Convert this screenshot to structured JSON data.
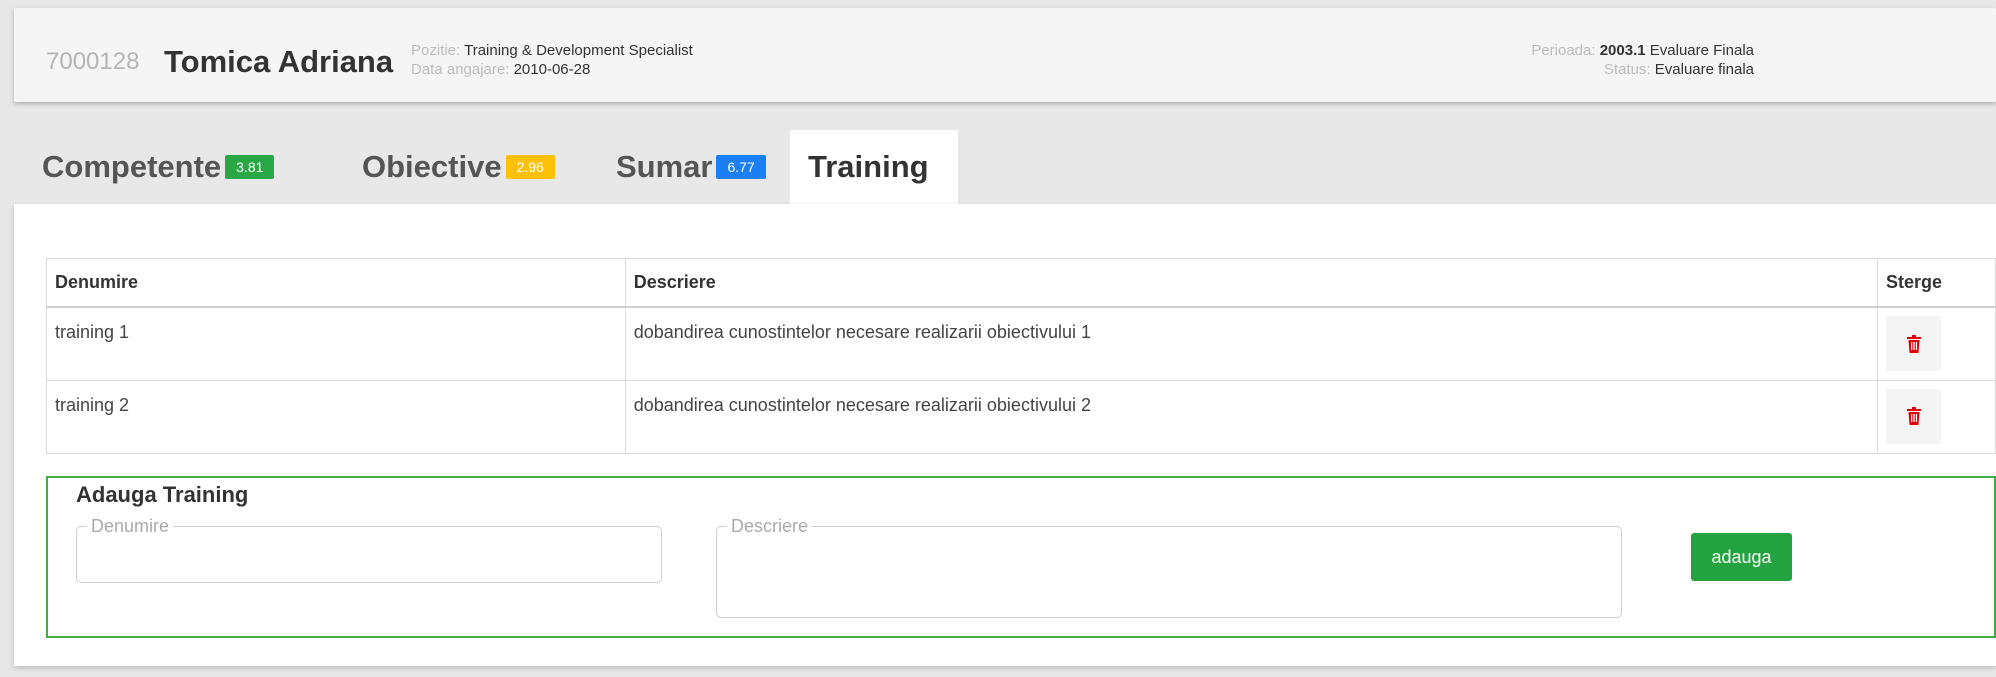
{
  "employee": {
    "id": "7000128",
    "name": "Tomica Adriana",
    "position_label": "Pozitie:",
    "position": "Training & Development Specialist",
    "hire_label": "Data angajare:",
    "hire_date": "2010-06-28",
    "period_label": "Perioada:",
    "period_code": "2003.1",
    "period_name": "Evaluare Finala",
    "status_label": "Status:",
    "status": "Evaluare finala"
  },
  "tabs": [
    {
      "label": "Competente",
      "badge": "3.81",
      "badge_color": "#28a745"
    },
    {
      "label": "Obiective",
      "badge": "2.96",
      "badge_color": "#ffc107"
    },
    {
      "label": "Sumar",
      "badge": "6.77",
      "badge_color": "#1a7ef5"
    },
    {
      "label": "Training",
      "badge": "",
      "active": true
    }
  ],
  "table": {
    "headers": [
      "Denumire",
      "Descriere",
      "Sterge"
    ],
    "rows": [
      {
        "denumire": "training 1",
        "descriere": "dobandirea cunostintelor necesare realizarii obiectivului 1"
      },
      {
        "denumire": "training 2",
        "descriere": "dobandirea cunostintelor necesare realizarii obiectivului 2"
      }
    ],
    "delete_icon": "trash-icon",
    "delete_color": "#e00000"
  },
  "add_form": {
    "title": "Adauga Training",
    "denumire_label": "Denumire",
    "denumire_value": "",
    "descriere_label": "Descriere",
    "descriere_value": "",
    "button_label": "adauga",
    "border_color": "#3fae49"
  }
}
